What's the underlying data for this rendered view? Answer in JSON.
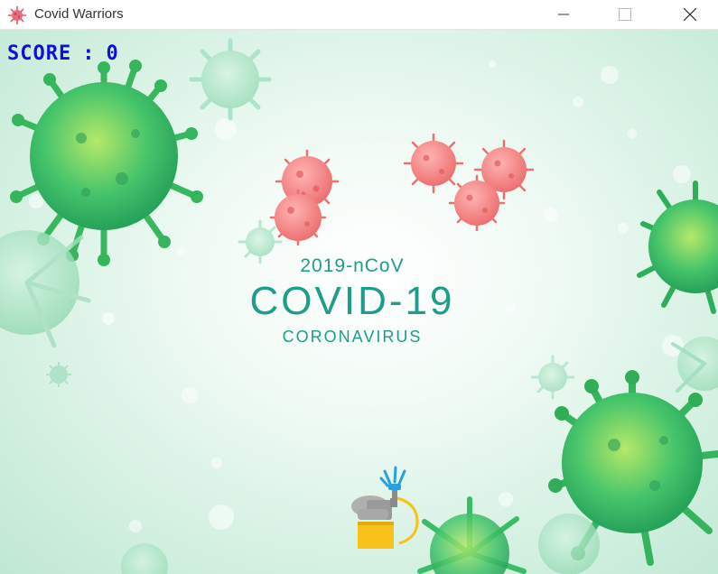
{
  "window": {
    "title": "Covid Warriors",
    "icon": "virus-icon",
    "controls": [
      "minimize-icon",
      "maximize-icon",
      "close-icon"
    ]
  },
  "hud": {
    "score_label": "SCORE",
    "score_separator": ":",
    "score_value": "0"
  },
  "banner": {
    "subtitle_top": "2019-nCoV",
    "title": "COVID-19",
    "subtitle_bottom": "CORONAVIRUS"
  },
  "sprites": {
    "player": "sanitizer-sprayer-player",
    "enemies": [
      "red-virus",
      "red-virus",
      "red-virus",
      "red-virus",
      "red-virus"
    ]
  },
  "colors": {
    "score_text": "#1010d8",
    "banner_text": "#1d9d8a",
    "enemy_virus": "#f07a7a",
    "background_virus": "#3fc46a",
    "player_tank": "#f7c21a",
    "player_body": "#a8a8a8",
    "spray": "#2aa0e0"
  }
}
